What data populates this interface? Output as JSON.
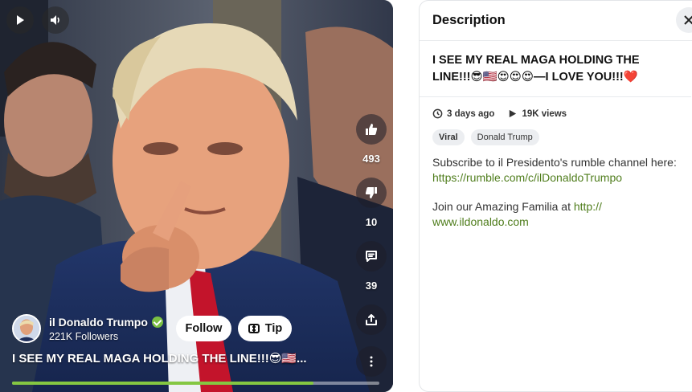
{
  "player": {
    "play_icon": "play-icon",
    "volume_icon": "volume-icon",
    "likes": "493",
    "dislikes": "10",
    "comments": "39",
    "progress_fraction": 0.82
  },
  "creator": {
    "name": "il Donaldo Trumpo",
    "followers": "221K Followers",
    "follow_label": "Follow",
    "tip_label": "Tip"
  },
  "video": {
    "title": "I SEE MY REAL MAGA HOLDING THE LINE!!!😎🇺🇸..."
  },
  "description": {
    "heading": "Description",
    "title": "I SEE MY REAL MAGA HOLDING THE LINE!!!😎🇺🇸😍😍😍—I LOVE YOU!!!❤️",
    "posted": "3 days ago",
    "views": "19K views",
    "tags": [
      "Viral",
      "Donald Trump"
    ],
    "para1_text": "Subscribe to il Presidento's rumble channel here:",
    "para1_link": "https://rumble.com/c/ilDonaldoTrumpo",
    "para2_text": "Join our Amazing Familia at ",
    "para2_link_a": "http://",
    "para2_link_b": "www.ildonaldo.com"
  },
  "colors": {
    "accent_green": "#85c742",
    "link_green": "#4f7d1c",
    "verified_green": "#7bc043"
  }
}
